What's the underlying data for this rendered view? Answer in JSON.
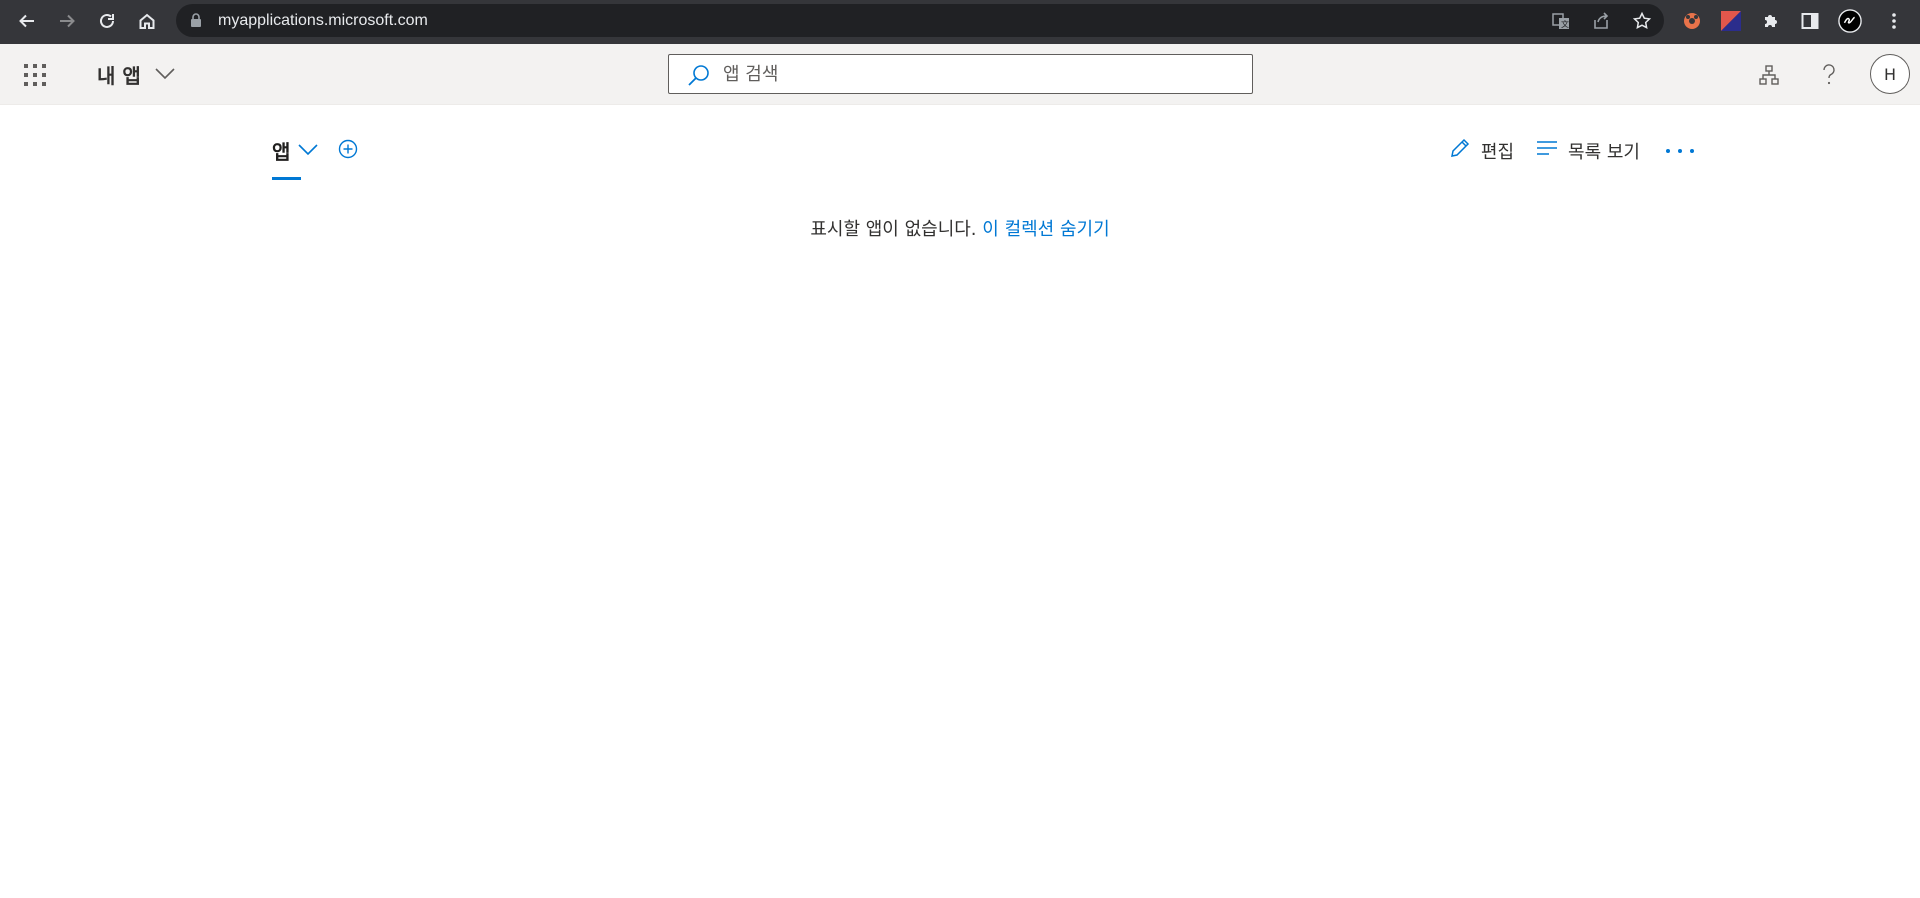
{
  "browser": {
    "url": "myapplications.microsoft.com",
    "toolbar_icons": [
      "back-icon",
      "forward-icon",
      "reload-icon",
      "home-icon"
    ],
    "omnibox_icons": [
      "translate-icon",
      "share-icon",
      "bookmark-star-icon"
    ],
    "extension_icons": [
      "extension-red-icon",
      "extension-flag-icon",
      "puzzle-icon",
      "side-panel-icon",
      "profile-icon",
      "kebab-menu-icon"
    ]
  },
  "header": {
    "title": "내 앱",
    "search_placeholder": "앱 검색",
    "avatar_initial": "H",
    "icons": [
      "waffle-icon",
      "chevron-down-icon",
      "search-icon",
      "org-chart-icon",
      "help-icon"
    ]
  },
  "main": {
    "tab_label": "앱",
    "actions": {
      "edit": "편집",
      "list_view": "목록 보기"
    },
    "empty_message": "표시할 앱이 없습니다.",
    "hide_link": "이 컬렉션 숨기기"
  },
  "colors": {
    "accent": "#0078d4",
    "chrome_bg": "#35363a",
    "header_bg": "#f3f2f1"
  }
}
